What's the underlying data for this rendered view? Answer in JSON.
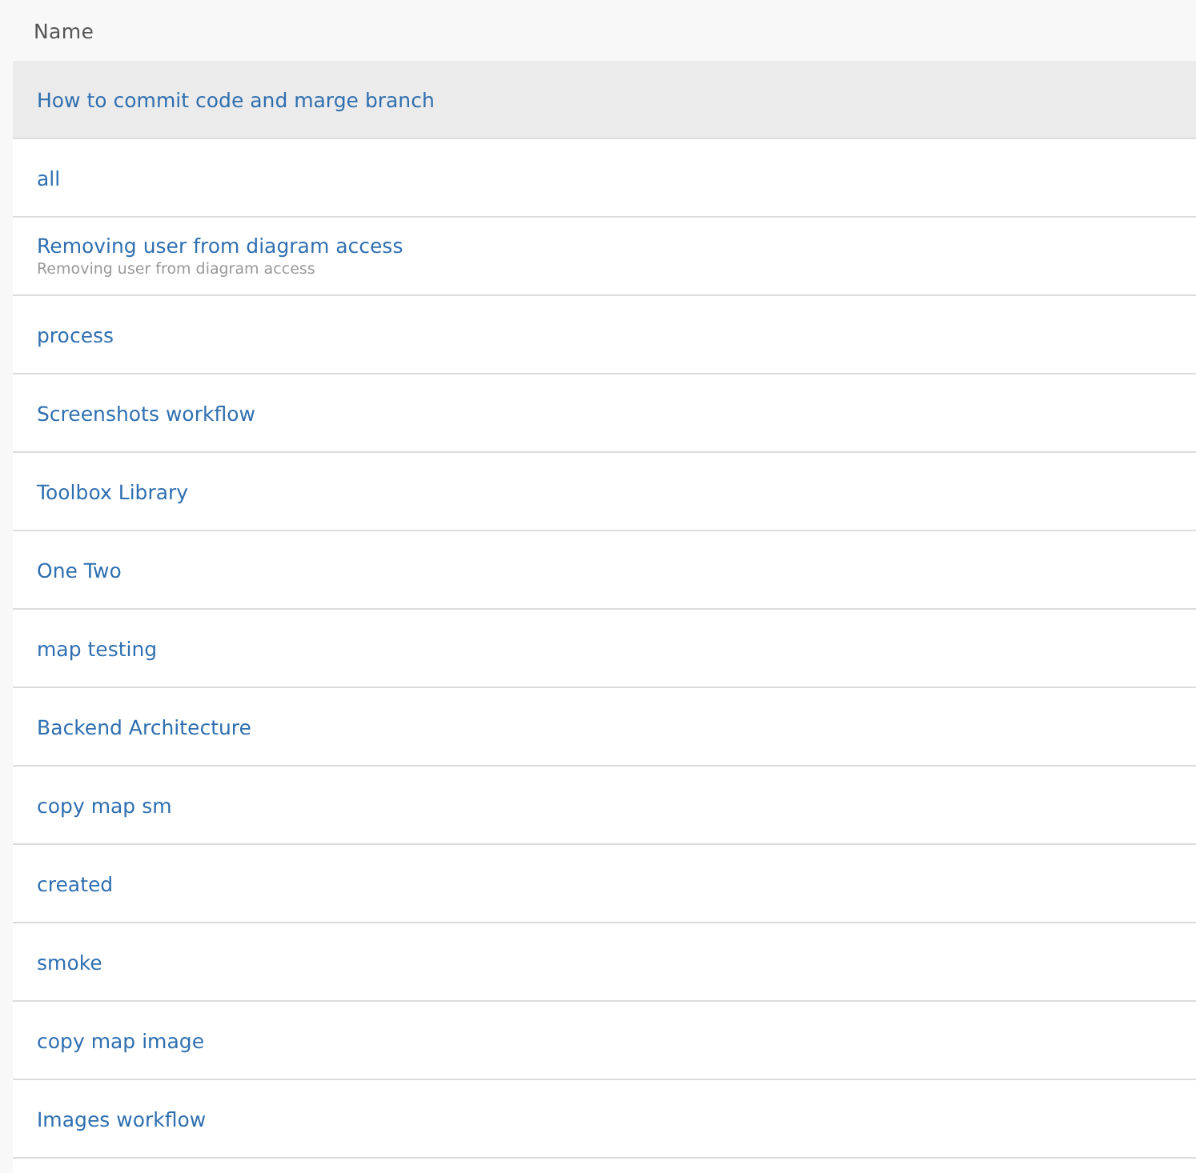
{
  "table": {
    "columns": [
      "Name"
    ],
    "rows": [
      {
        "name": "How to commit code and marge branch",
        "selected": true
      },
      {
        "name": "all",
        "selected": false
      },
      {
        "name": "Removing user from diagram access",
        "description": "Removing user from diagram access",
        "selected": false
      },
      {
        "name": "process",
        "selected": false
      },
      {
        "name": "Screenshots workflow",
        "selected": false
      },
      {
        "name": "Toolbox Library",
        "selected": false
      },
      {
        "name": "One Two",
        "selected": false
      },
      {
        "name": "map testing",
        "selected": false
      },
      {
        "name": "Backend Architecture",
        "selected": false
      },
      {
        "name": "copy map sm",
        "selected": false
      },
      {
        "name": "created",
        "selected": false
      },
      {
        "name": "smoke",
        "selected": false
      },
      {
        "name": "copy map image",
        "selected": false
      },
      {
        "name": "Images workflow",
        "selected": false
      }
    ]
  }
}
